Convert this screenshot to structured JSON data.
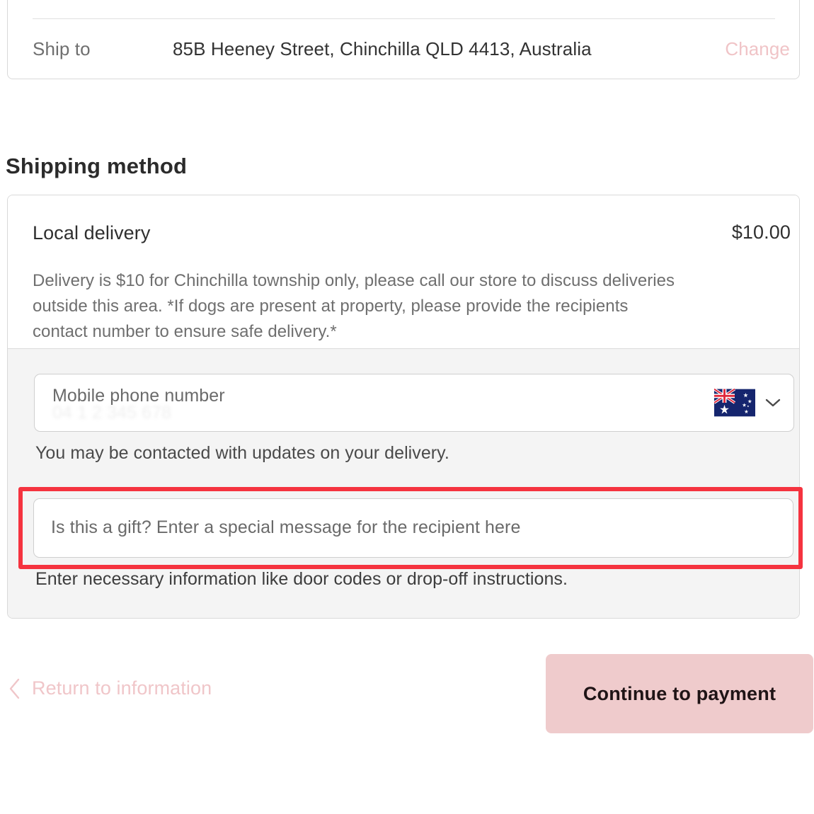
{
  "ship_to": {
    "label": "Ship to",
    "address": "85B Heeney Street, Chinchilla QLD 4413, Australia",
    "change_label": "Change"
  },
  "shipping_section": {
    "title": "Shipping method",
    "method": {
      "name": "Local delivery",
      "price": "$10.00",
      "description": "Delivery is $10 for Chinchilla township only, please call our store to discuss deliveries outside this area. *If dogs are present at property, please provide the recipients contact number to ensure safe delivery.*"
    },
    "phone": {
      "placeholder": "Mobile phone number",
      "value": "",
      "country_flag": "australia-flag-icon",
      "help_text": "You may be contacted with updates on your delivery."
    },
    "delivery_instructions": {
      "placeholder": "Is this a gift? Enter a special message for the recipient here",
      "value": "",
      "help_text": "Enter necessary information like door codes or drop-off instructions."
    }
  },
  "footer": {
    "return_label": "Return to information",
    "continue_label": "Continue to payment"
  },
  "annotation": {
    "highlight_color": "#f5333f",
    "target": "delivery-instructions-input"
  },
  "colors": {
    "accent_pink": "#efcbcc",
    "link_pink": "#f0c4c7",
    "panel_grey": "#f4f4f4",
    "border_grey": "#d9d9d9"
  }
}
